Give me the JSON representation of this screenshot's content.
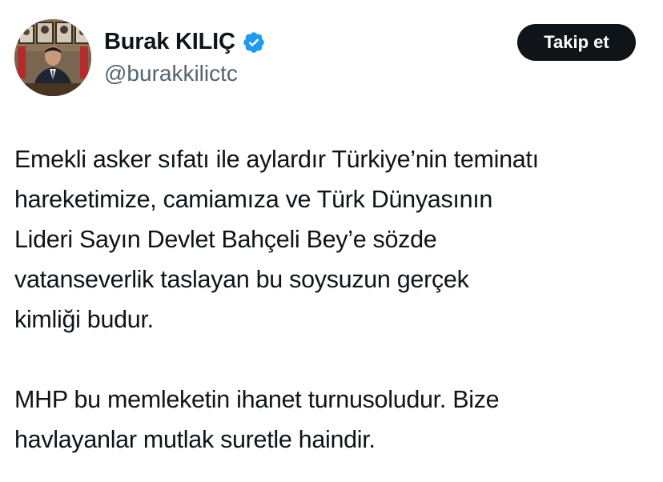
{
  "author": {
    "display_name": "Burak KILIÇ",
    "handle": "@burakkilictc",
    "verified_icon": "verified-badge-icon",
    "verified_color": "#1d9bf0",
    "avatar_icon": "profile-photo"
  },
  "follow_button": {
    "label": "Takip et",
    "background": "#0f1419",
    "text_color": "#ffffff"
  },
  "tweet": {
    "paragraphs": [
      "Emekli asker sıfatı ile aylardır Türkiye’nin teminatı\nhareketimize, camiamıza ve Türk Dünyasının\nLideri Sayın Devlet Bahçeli Bey’e sözde\nvatanseverlik taslayan bu soysuzun gerçek\nkimliği budur.",
      "MHP bu memleketin ihanet turnusoludur. Bize\nhavlayanlar mutlak suretle haindir."
    ]
  },
  "colors": {
    "text_primary": "#0f1419",
    "text_secondary": "#536471",
    "background": "#ffffff"
  }
}
